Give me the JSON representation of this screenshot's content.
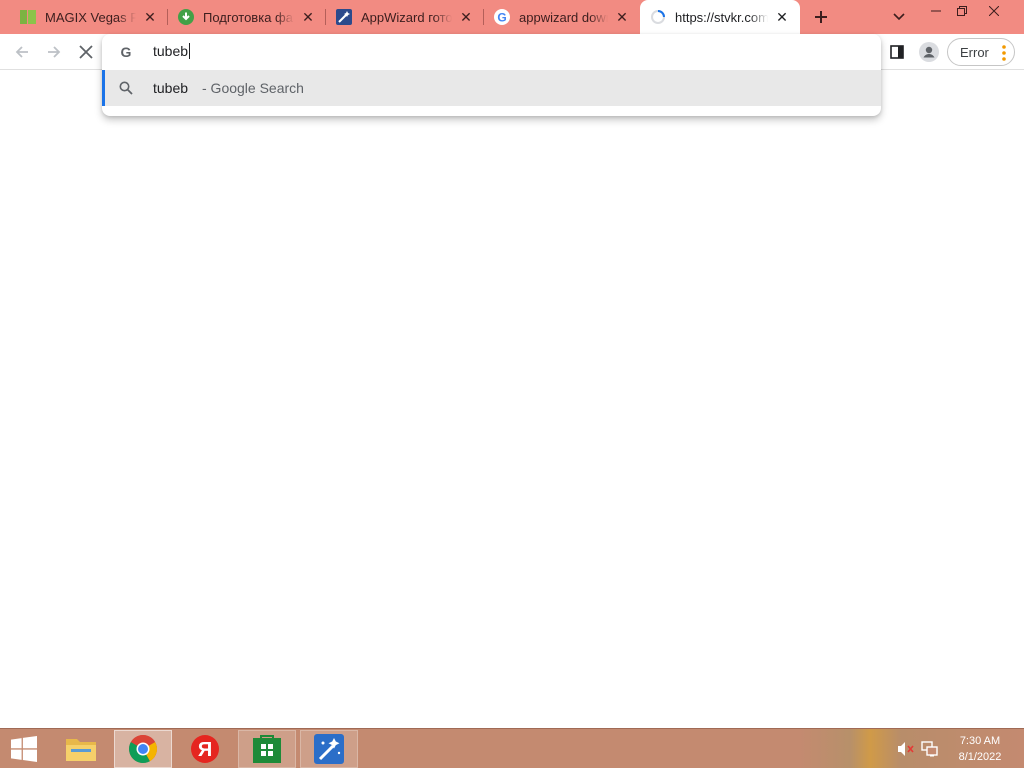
{
  "tabs": [
    {
      "title": "MAGIX Vegas Pro",
      "icon": "magix-vegas-icon"
    },
    {
      "title": "Подготовка файла",
      "icon": "download-arrow-icon"
    },
    {
      "title": "AppWizard готов",
      "icon": "appwizard-icon"
    },
    {
      "title": "appwizard download",
      "icon": "google-icon"
    },
    {
      "title": "https://stvkr.com/",
      "icon": "loading-spinner-icon",
      "active": true
    }
  ],
  "omnibox": {
    "value": "tubeb",
    "suggestion": {
      "query": "tubeb",
      "description": "- Google Search"
    }
  },
  "profile": {
    "error_label": "Error"
  },
  "taskbar": {
    "apps": [
      "file-explorer",
      "chrome",
      "yandex",
      "store",
      "appwizard"
    ],
    "clock_time": "7:30 AM",
    "clock_date": "8/1/2022"
  },
  "colors": {
    "tabstrip": "#f28b82",
    "accent": "#1a73e8",
    "taskbar": "#c48a70"
  }
}
